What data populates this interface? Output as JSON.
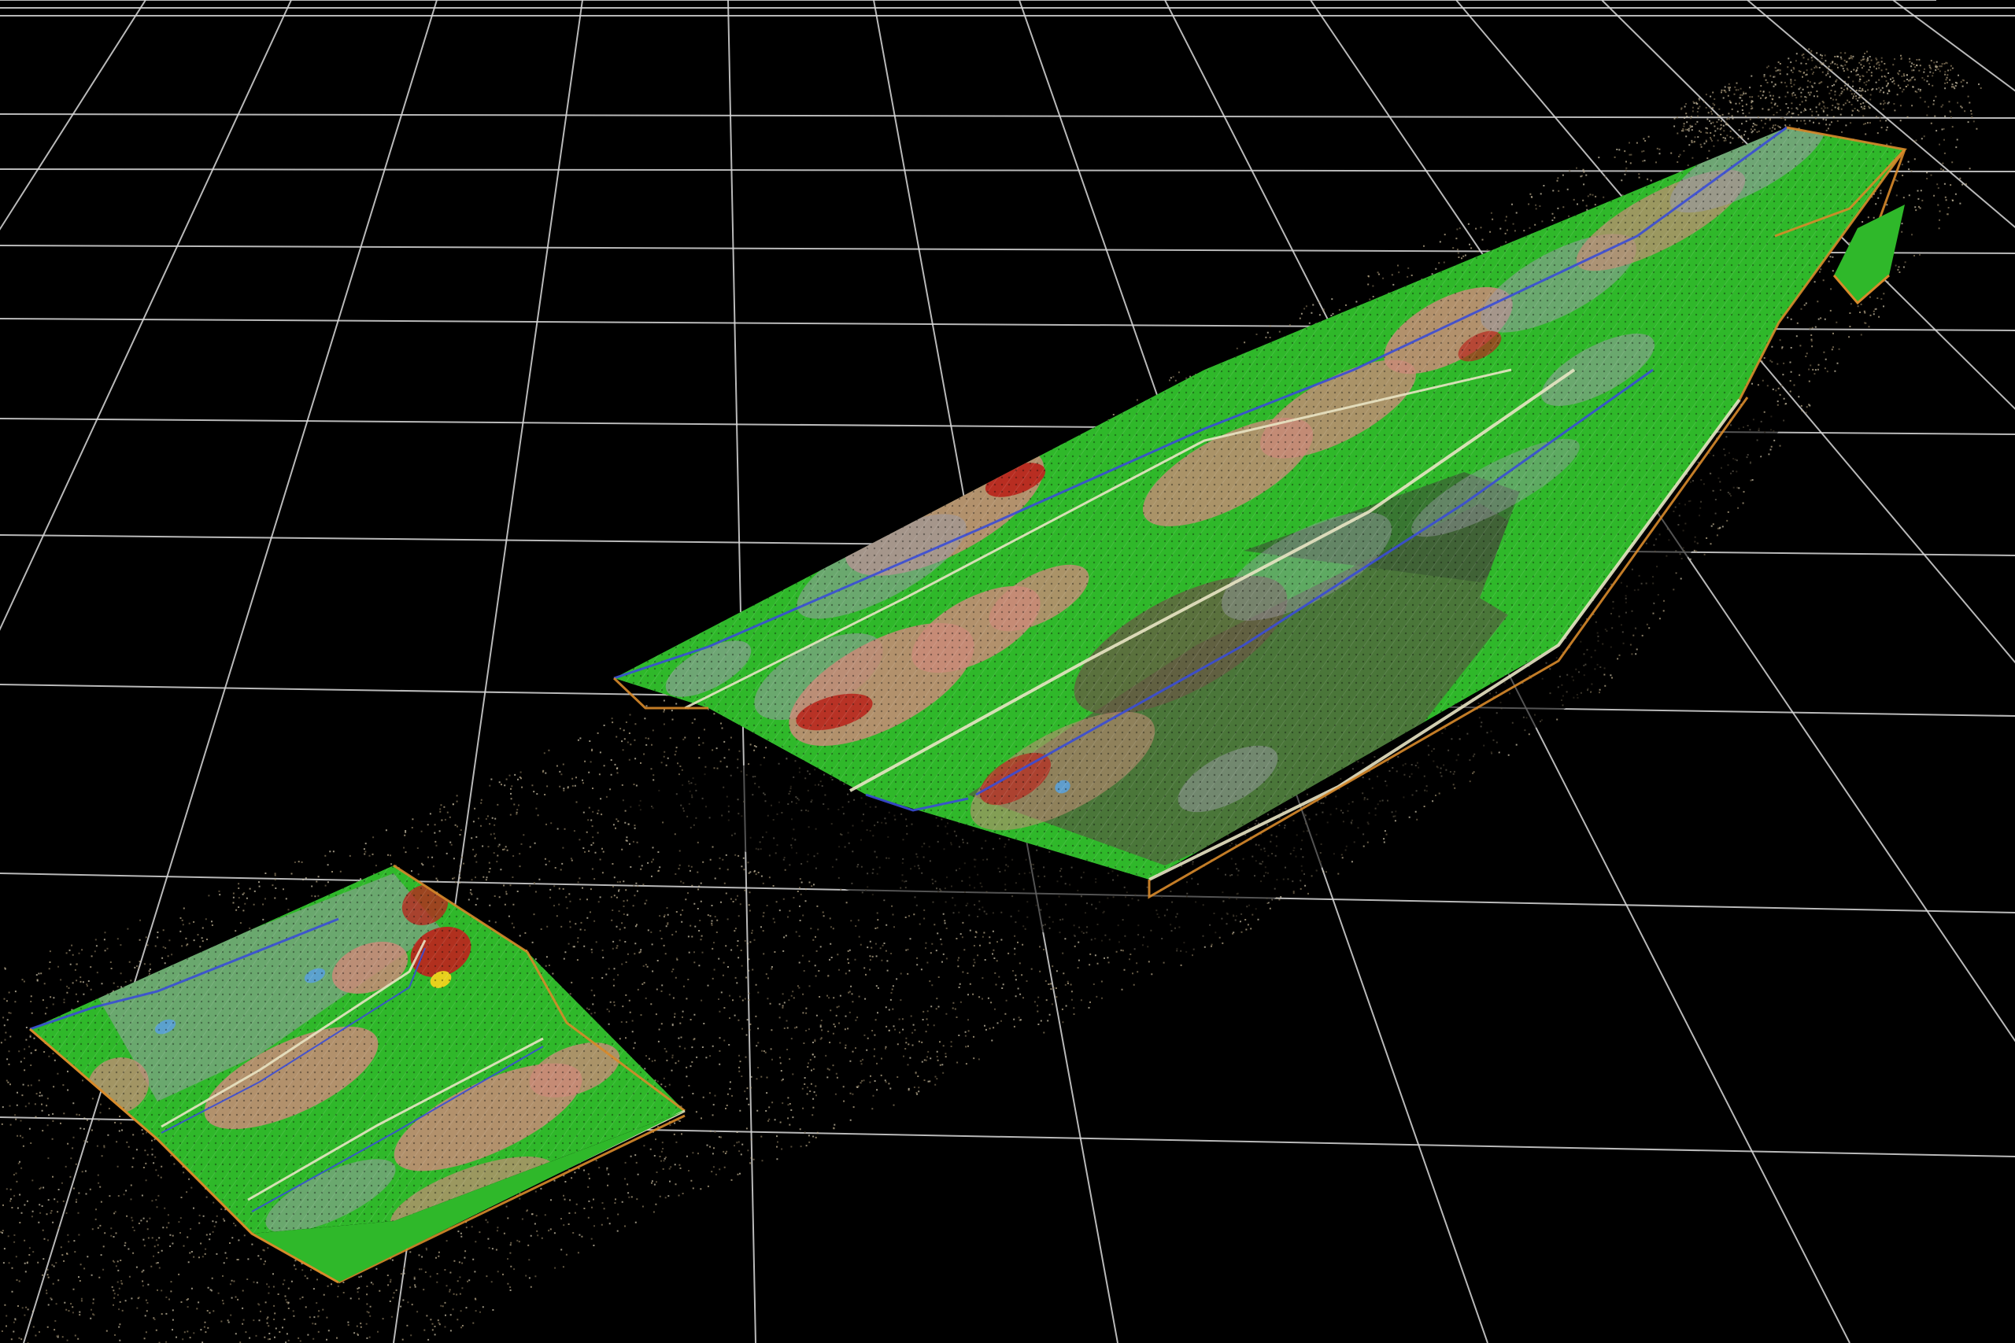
{
  "scene": {
    "type": "3d-point-cloud-viewport",
    "background_color": "#000000",
    "grid_color": "#d9d9d9",
    "point_cloud_colors": [
      "#8a7a5c",
      "#b8a888",
      "#6e6048",
      "#c9c0a8"
    ],
    "surface_colors": {
      "fit_good": "#2fb82a",
      "fit_low": "#c98a78",
      "fit_high": "#b8281e",
      "fit_peak": "#e8d11c",
      "fit_neutral": "#9a9aa6",
      "fit_cool": "#5aa0d8",
      "edge_blue": "#3a4cd6",
      "edge_orange": "#d88a2a",
      "seam": "#e9e4c4"
    },
    "objects": [
      {
        "name": "large-surface-model"
      },
      {
        "name": "small-surface-model"
      }
    ]
  }
}
